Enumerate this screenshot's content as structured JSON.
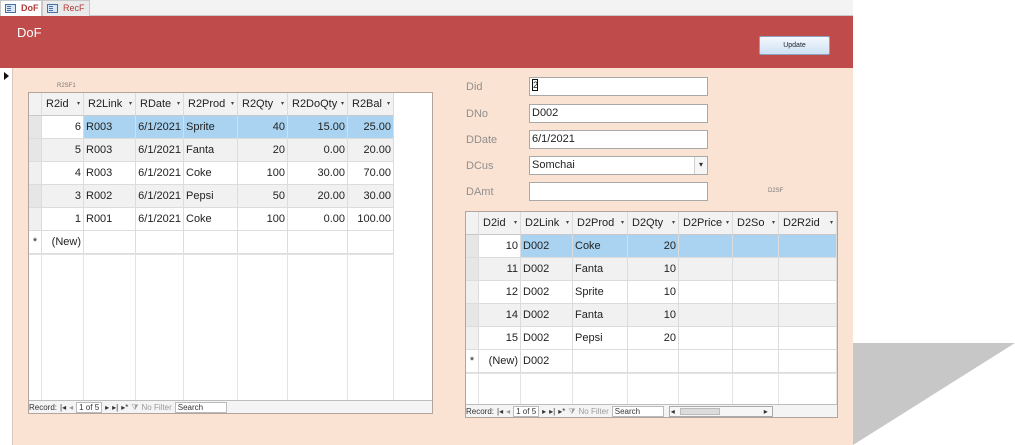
{
  "tabs": [
    {
      "label": "DoF",
      "active": true
    },
    {
      "label": "RecF",
      "active": false
    }
  ],
  "form": {
    "title": "DoF",
    "update_label": "Update"
  },
  "r2sf": {
    "caption": "R2SF1",
    "columns": [
      "R2id",
      "R2Link",
      "RDate",
      "R2Prod",
      "R2Qty",
      "R2DoQty",
      "R2Bal"
    ],
    "rows": [
      [
        "6",
        "R003",
        "6/1/2021",
        "Sprite",
        "40",
        "15.00",
        "25.00"
      ],
      [
        "5",
        "R003",
        "6/1/2021",
        "Fanta",
        "20",
        "0.00",
        "20.00"
      ],
      [
        "4",
        "R003",
        "6/1/2021",
        "Coke",
        "100",
        "30.00",
        "70.00"
      ],
      [
        "3",
        "R002",
        "6/1/2021",
        "Pepsi",
        "50",
        "20.00",
        "30.00"
      ],
      [
        "1",
        "R001",
        "6/1/2021",
        "Coke",
        "100",
        "0.00",
        "100.00"
      ]
    ],
    "new_row": {
      "marker": "*",
      "label": "(New)"
    },
    "nav": {
      "record_label": "Record:",
      "position": "1 of 5",
      "filter": "No Filter",
      "search": "Search"
    }
  },
  "fields": {
    "did": {
      "label": "Did",
      "value": "2"
    },
    "dno": {
      "label": "DNo",
      "value": "D002"
    },
    "ddate": {
      "label": "DDate",
      "value": "6/1/2021"
    },
    "dcus": {
      "label": "DCus",
      "value": "Somchai"
    },
    "damt": {
      "label": "DAmt",
      "value": ""
    }
  },
  "d2sf": {
    "caption": "D2SF",
    "columns": [
      "D2id",
      "D2Link",
      "D2Prod",
      "D2Qty",
      "D2Price",
      "D2So",
      "D2R2id"
    ],
    "rows": [
      [
        "10",
        "D002",
        "Coke",
        "20",
        "",
        "",
        ""
      ],
      [
        "11",
        "D002",
        "Fanta",
        "10",
        "",
        "",
        ""
      ],
      [
        "12",
        "D002",
        "Sprite",
        "10",
        "",
        "",
        ""
      ],
      [
        "14",
        "D002",
        "Fanta",
        "10",
        "",
        "",
        ""
      ],
      [
        "15",
        "D002",
        "Pepsi",
        "20",
        "",
        "",
        ""
      ]
    ],
    "new_row": {
      "marker": "*",
      "label": "(New)",
      "link": "D002"
    },
    "nav": {
      "record_label": "Record:",
      "position": "1 of 5",
      "filter": "No Filter",
      "search": "Search"
    }
  },
  "colors": {
    "header": "#bf4b4b",
    "detail": "#fbe3d3",
    "selected_row": "#a9d3f0"
  },
  "icons": {
    "record_selector": "record-selector-arrow-icon",
    "form_tab": "form-icon",
    "nav_first": "first-record-icon",
    "nav_prev": "prev-record-icon",
    "nav_next": "next-record-icon",
    "nav_last": "last-record-icon",
    "nav_new": "new-record-icon",
    "filter": "filter-icon"
  }
}
